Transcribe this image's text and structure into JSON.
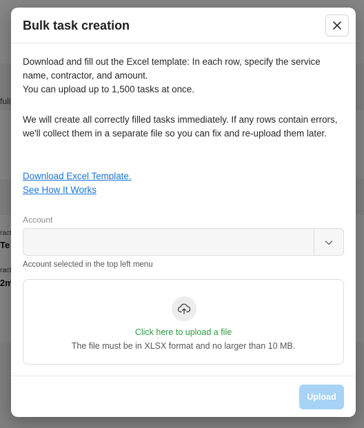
{
  "background": {
    "fragment_full": "full",
    "fragment_contractor_1": "ract",
    "fragment_te": "Te",
    "fragment_contractor_2": "ract",
    "fragment_2m": "2m"
  },
  "modal": {
    "title": "Bulk task creation",
    "intro": "Download and fill out the Excel template: In each row, specify the service name, contractor, and amount. You can upload up to 1,500 tasks at once.",
    "intro_line1": "Download and fill out the Excel template: In each row, specify the service name, contractor, and amount.",
    "intro_line2": "You can upload up to 1,500 tasks at once.",
    "errors_note": "We will create all correctly filled tasks immediately. If any rows contain errors, we'll collect them in a separate file so you can fix and re-upload them later.",
    "download_link": "Download Excel Template.",
    "how_it_works_link": "See How It Works",
    "account": {
      "label": "Account",
      "value": "",
      "hint": "Account selected in the top left menu"
    },
    "dropzone": {
      "action": "Click here to upload a file",
      "hint": "The file must be in XLSX format and no larger than 10 MB."
    },
    "upload_button": "Upload",
    "upload_enabled": false
  },
  "icons": {
    "close": "close-icon",
    "chevron": "chevron-down-icon",
    "upload": "cloud-upload-icon"
  },
  "colors": {
    "link": "#1a73d9",
    "upload_link": "#2e9a3e",
    "upload_button_disabled": "#a6d3f6"
  }
}
